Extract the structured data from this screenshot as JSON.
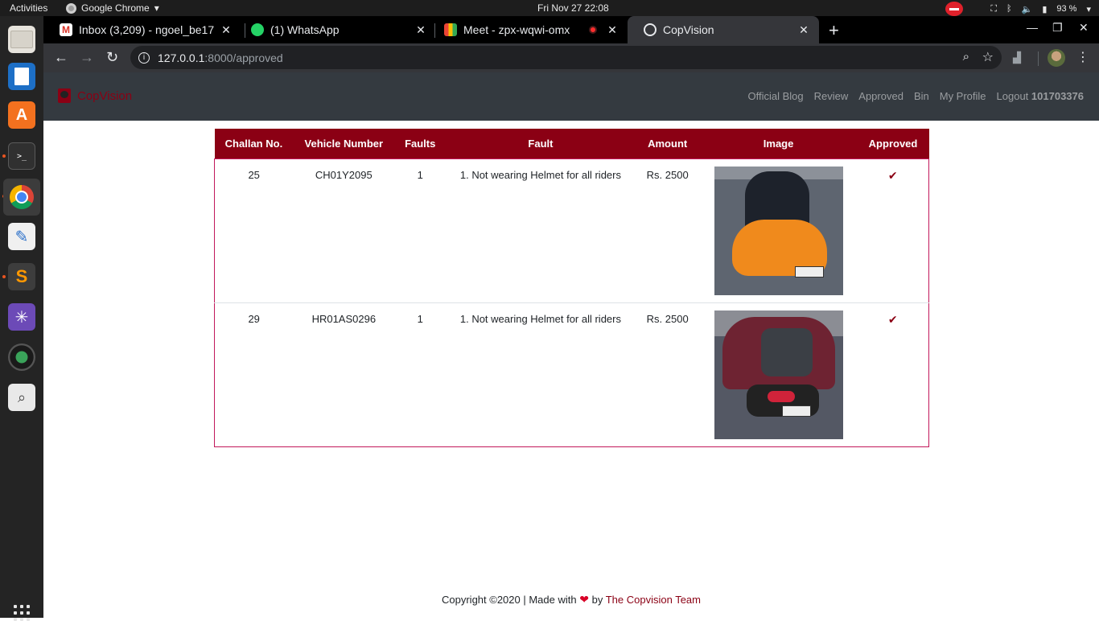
{
  "system": {
    "activities": "Activities",
    "app_name": "Google Chrome",
    "clock": "Fri Nov 27  22:08",
    "battery": "93 %"
  },
  "browser": {
    "tabs": [
      {
        "title": "Inbox (3,209) - ngoel_be17",
        "icon": "gmail-icon"
      },
      {
        "title": "(1) WhatsApp",
        "icon": "whatsapp-icon"
      },
      {
        "title": "Meet - zpx-wqwi-omx",
        "icon": "meet-icon"
      },
      {
        "title": "CopVision",
        "icon": "globe-icon",
        "active": true
      }
    ],
    "url_host": "127.0.0.1",
    "url_path": ":8000/approved"
  },
  "site": {
    "brand": "CopVision",
    "nav": {
      "official_blog": "Official Blog",
      "review": "Review",
      "approved": "Approved",
      "bin": "Bin",
      "my_profile": "My Profile",
      "logout": "Logout",
      "user_id": "101703376"
    },
    "colors": {
      "accent": "#8b0014",
      "navbar": "#343a40"
    }
  },
  "table": {
    "headers": [
      "Challan No.",
      "Vehicle Number",
      "Faults",
      "Fault",
      "Amount",
      "Image",
      "Approved"
    ],
    "rows": [
      {
        "challan_no": "25",
        "vehicle_number": "CH01Y2095",
        "faults": "1",
        "fault": "1. Not wearing Helmet for all riders",
        "amount": "Rs. 2500",
        "approved": "✔"
      },
      {
        "challan_no": "29",
        "vehicle_number": "HR01AS0296",
        "faults": "1",
        "fault": "1. Not wearing Helmet for all riders",
        "amount": "Rs. 2500",
        "approved": "✔"
      }
    ]
  },
  "footer": {
    "copyright": "Copyright ©2020 | Made with",
    "heart": "❤",
    "by": "by",
    "team": "The Copvision Team"
  }
}
